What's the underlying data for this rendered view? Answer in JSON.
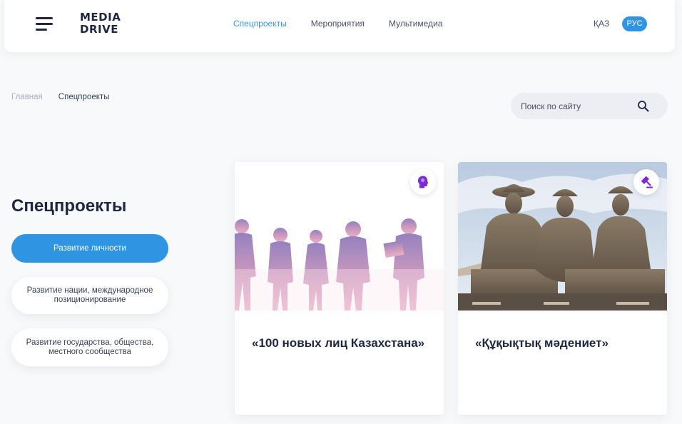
{
  "header": {
    "logo_line1": "MEDIA",
    "logo_line2": "DRIVE",
    "nav": [
      "Спецпроекты",
      "Мероприятия",
      "Мультимедиа"
    ],
    "lang_kaz": "ҚАЗ",
    "lang_rus": "РУС"
  },
  "breadcrumb": {
    "home": "Главная",
    "current": "Спецпроекты"
  },
  "search": {
    "placeholder": "Поиск по сайту",
    "icon": "search-icon"
  },
  "page_title": "Спецпроекты",
  "categories": [
    "Развитие личности",
    "Развитие нации, международное позиционирование",
    "Развитие государства, общества, местного сообщества"
  ],
  "cards": [
    {
      "title": "«100 новых лиц Казахстана»",
      "icon": "head-icon"
    },
    {
      "title": "«Құқықтық мәдениет»",
      "icon": "gavel-icon"
    }
  ],
  "colors": {
    "accent": "#2f95e3",
    "nav_active": "#3a96e0",
    "badge_icon": "#7b2ad6",
    "title": "#1d2740"
  }
}
